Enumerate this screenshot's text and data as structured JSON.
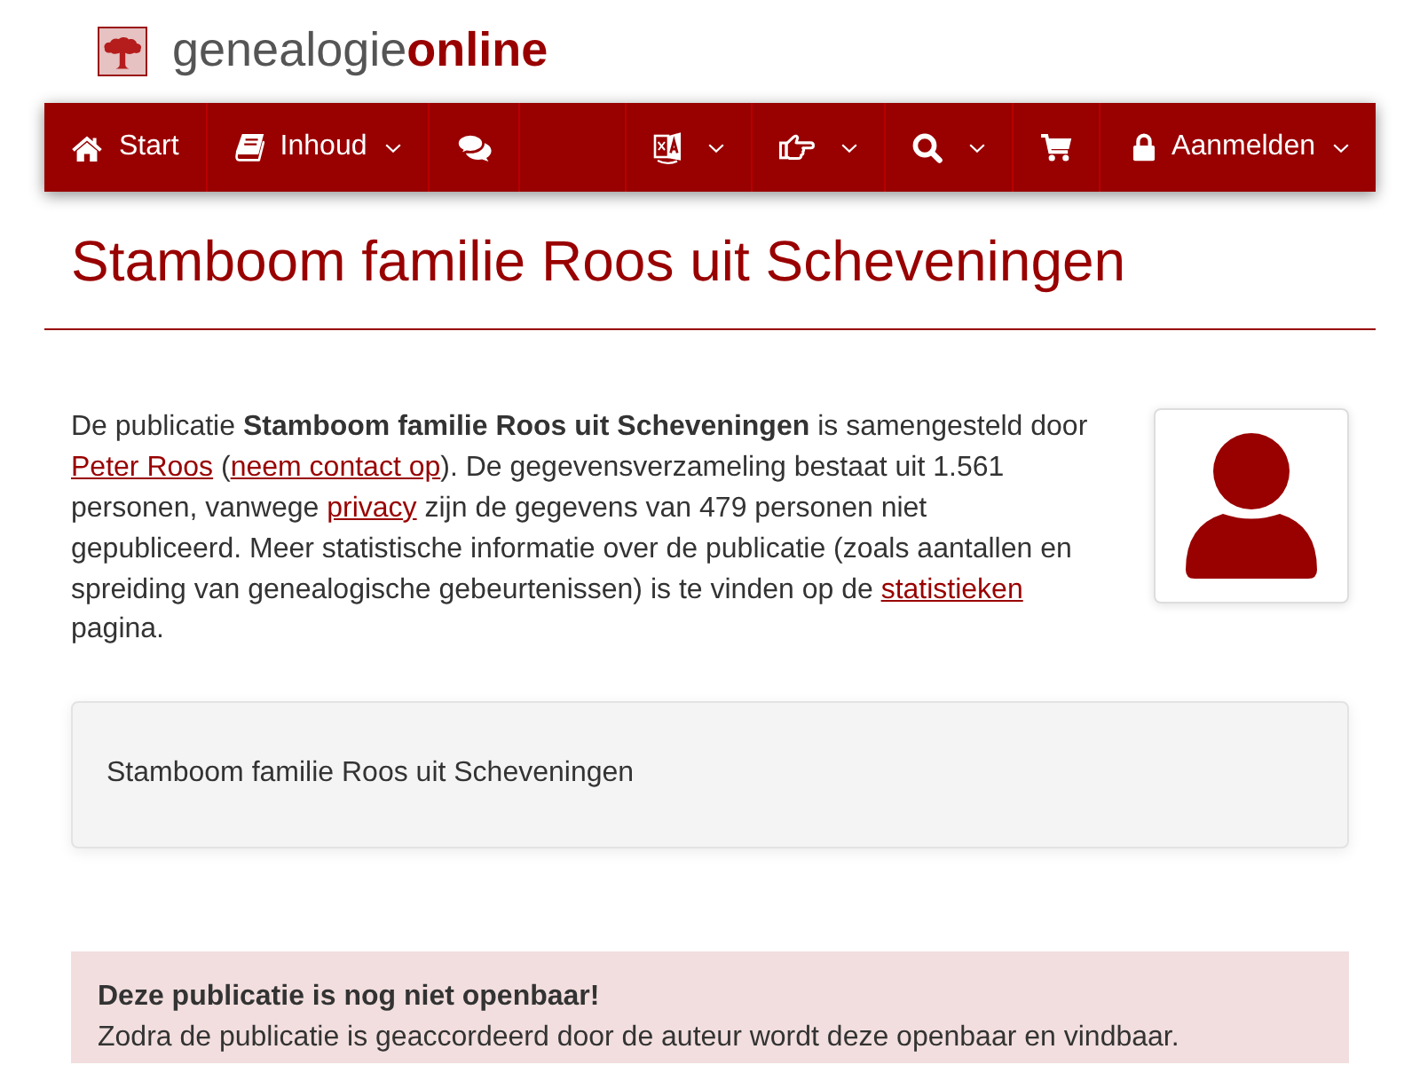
{
  "brand": {
    "name_regular": "genealogie",
    "name_bold": "online"
  },
  "navbar": {
    "left": [
      {
        "label": "Start",
        "has_menu": false
      },
      {
        "label": "Inhoud",
        "has_menu": true
      },
      {
        "has_menu": false
      }
    ],
    "right": [
      {
        "has_menu": true
      },
      {
        "has_menu": true
      },
      {
        "has_menu": true
      },
      {
        "has_menu": false
      },
      {
        "label": "Aanmelden",
        "has_menu": true
      }
    ]
  },
  "title": "Stamboom familie Roos uit Scheveningen",
  "description": [
    {
      "kind": "text",
      "text": "De publicatie **Stamboom familie Roos uit Scheveningen** is samengesteld door "
    },
    {
      "kind": "link",
      "text": "Peter Roos"
    },
    {
      "kind": "text",
      "text": " ("
    },
    {
      "kind": "link",
      "text": "neem contact op"
    },
    {
      "kind": "text",
      "text": "). De gegevensverzameling bestaat uit 1.561 personen, vanwege "
    },
    {
      "kind": "link",
      "text": "privacy"
    },
    {
      "kind": "text",
      "text": " zijn de gegevens van 479 personen niet gepubliceerd. Meer statistische informatie over de publicatie (zoals aantallen en spreiding van genealogische gebeurtenissen) is te vinden op de "
    },
    {
      "kind": "link",
      "text": "statistieken"
    },
    {
      "kind": "text",
      "text": " pagina."
    }
  ],
  "panel": {
    "text": "Stamboom familie Roos uit Scheveningen"
  },
  "alert": {
    "title": "Deze publicatie is nog niet openbaar!",
    "text": "Zodra de publicatie is geaccordeerd door de auteur wordt deze openbaar en vindbaar."
  }
}
